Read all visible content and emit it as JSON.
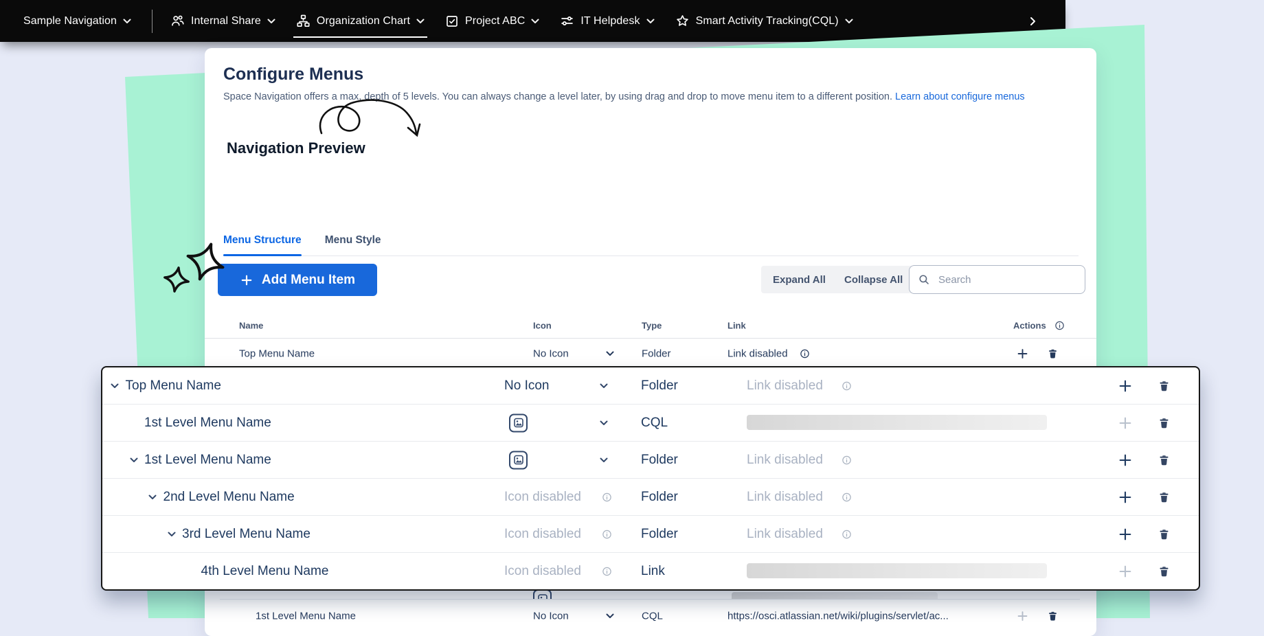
{
  "header": {
    "title": "Configure Menus",
    "description": "Space Navigation offers a max, depth of 5 levels. You can always change a level later, by using drag and drop to move menu item to a different position. ",
    "learn_link": "Learn about configure menus"
  },
  "preview_label": "Navigation Preview",
  "navbar": {
    "items": [
      {
        "label": "Sample Navigation",
        "icon": null,
        "divider_after": true,
        "active": false
      },
      {
        "label": "Internal Share",
        "icon": "people-icon",
        "active": false
      },
      {
        "label": "Organization Chart",
        "icon": "org-chart-icon",
        "active": true
      },
      {
        "label": "Project ABC",
        "icon": "checkbox-icon",
        "active": false
      },
      {
        "label": "IT Helpdesk",
        "icon": "sliders-icon",
        "active": false
      },
      {
        "label": "Smart Activity Tracking(CQL)",
        "icon": "star-icon",
        "active": false
      }
    ],
    "overflow_icon": "chevron-right-icon"
  },
  "tabs": [
    {
      "label": "Menu Structure",
      "active": true
    },
    {
      "label": "Menu Style",
      "active": false
    }
  ],
  "toolbar": {
    "add_button": "Add Menu Item",
    "expand_all": "Expand All",
    "collapse_all": "Collapse All",
    "search_placeholder": "Search"
  },
  "table": {
    "headers": {
      "name": "Name",
      "icon": "Icon",
      "type": "Type",
      "link": "Link",
      "actions": "Actions"
    },
    "background_rows": [
      {
        "name": "Top Menu Name",
        "icon_text": "No Icon",
        "type": "Folder",
        "link_text": "Link disabled",
        "add_enabled": true
      },
      {
        "name": "1st Level Menu Name",
        "icon_text": "No Icon",
        "type": "CQL",
        "link_text": "https://osci.atlassian.net/wiki/plugins/servlet/ac...",
        "add_enabled": false
      }
    ]
  },
  "overlay": {
    "rows": [
      {
        "level": 0,
        "expander": true,
        "name": "Top Menu Name",
        "icon": "text",
        "icon_text": "No Icon",
        "icon_chevron": true,
        "type": "Folder",
        "link": "disabled",
        "link_text": "Link disabled",
        "add_enabled": true
      },
      {
        "level": 1,
        "expander": false,
        "name": "1st Level Menu Name",
        "icon": "image",
        "icon_text": "",
        "icon_chevron": true,
        "type": "CQL",
        "link": "skeleton",
        "link_text": "",
        "add_enabled": false
      },
      {
        "level": 1,
        "expander": true,
        "name": "1st Level Menu Name",
        "icon": "image",
        "icon_text": "",
        "icon_chevron": true,
        "type": "Folder",
        "link": "disabled",
        "link_text": "Link disabled",
        "add_enabled": true
      },
      {
        "level": 2,
        "expander": true,
        "name": "2nd Level Menu Name",
        "icon": "disabled",
        "icon_text": "Icon disabled",
        "icon_chevron": false,
        "type": "Folder",
        "link": "disabled",
        "link_text": "Link disabled",
        "add_enabled": true
      },
      {
        "level": 3,
        "expander": true,
        "name": "3rd Level Menu Name",
        "icon": "disabled",
        "icon_text": "Icon disabled",
        "icon_chevron": false,
        "type": "Folder",
        "link": "disabled",
        "link_text": "Link disabled",
        "add_enabled": true
      },
      {
        "level": 4,
        "expander": false,
        "name": "4th Level Menu Name",
        "icon": "disabled",
        "icon_text": "Icon disabled",
        "icon_chevron": false,
        "type": "Link",
        "link": "skeleton",
        "link_text": "",
        "add_enabled": false
      }
    ]
  },
  "colors": {
    "accent_blue": "#1868db",
    "tab_blue": "#0c66e4",
    "navy_text": "#1e3a5f",
    "muted_text": "#44546f",
    "disabled_text": "#a9b2c2",
    "mint_green": "#a8f2d4",
    "page_bg": "#e6eaf7",
    "nav_black": "#0a0a0a"
  }
}
